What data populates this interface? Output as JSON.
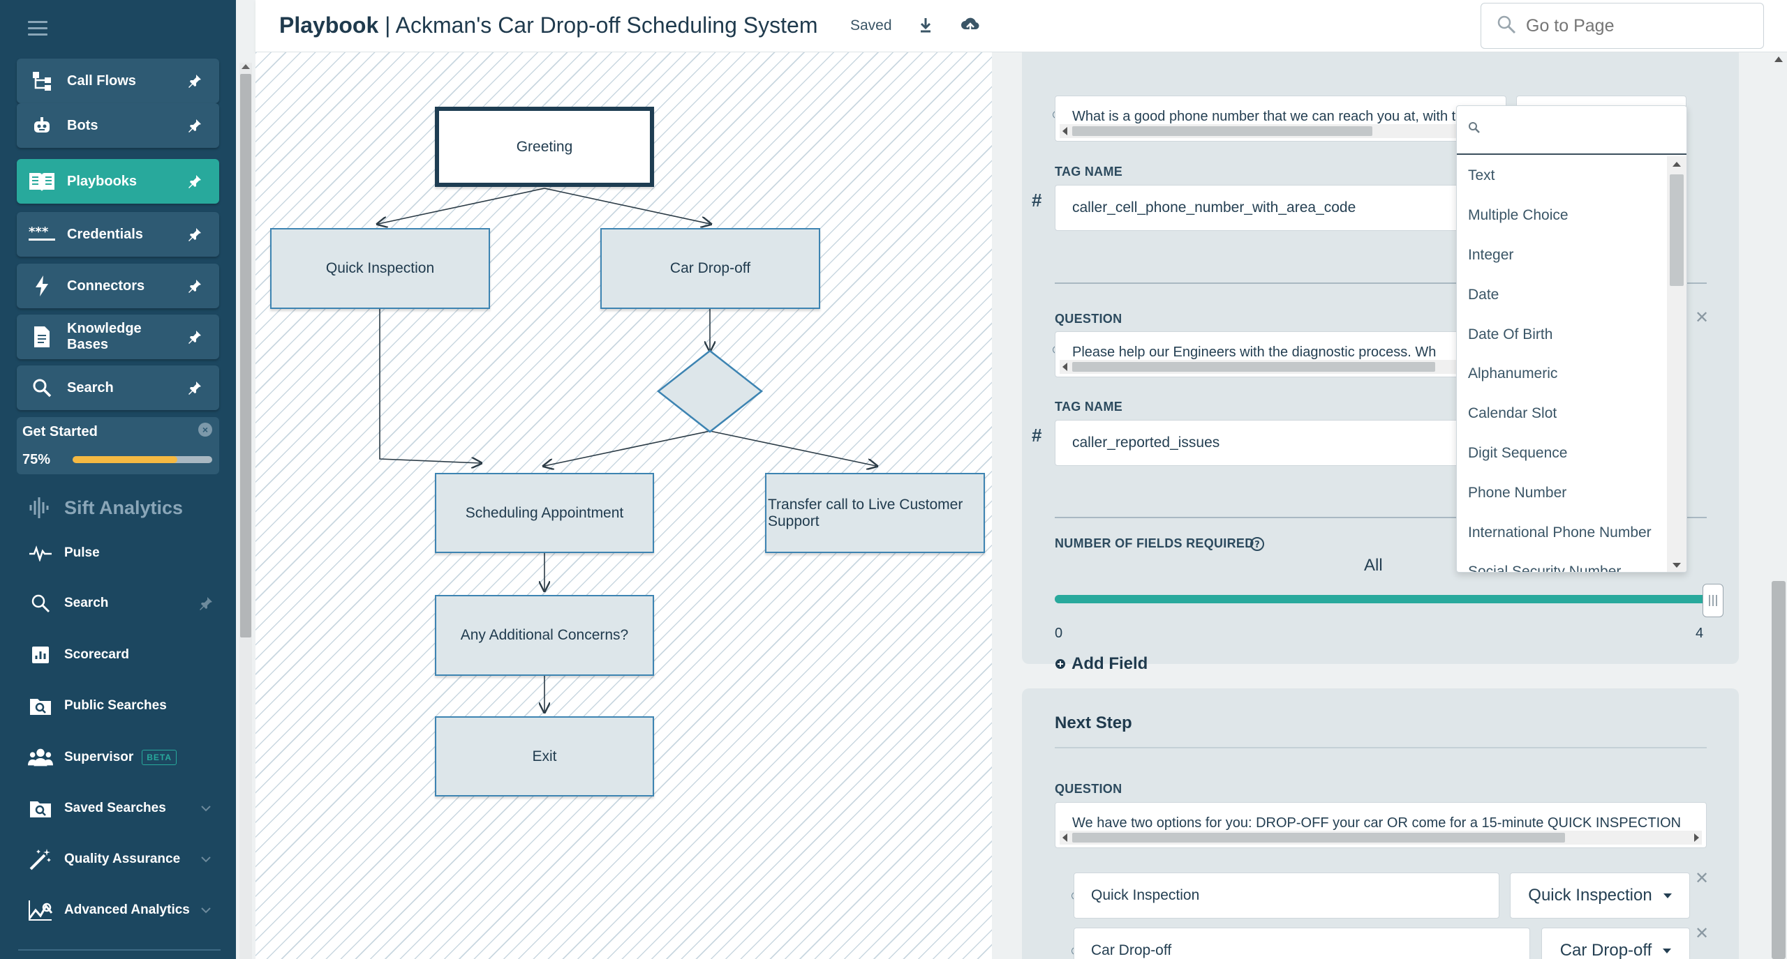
{
  "app": {
    "title_bold": "Playbook",
    "title_rest": "| Ackman's Car Drop-off Scheduling System",
    "saved": "Saved",
    "search_placeholder": "Go to Page"
  },
  "sidebar": {
    "pinned": [
      {
        "label": "Call Flows",
        "icon": "call-flows-icon"
      },
      {
        "label": "Bots",
        "icon": "bot-icon"
      },
      {
        "label": "Playbooks",
        "icon": "playbook-icon",
        "active": true
      },
      {
        "label": "Credentials",
        "icon": "credentials-icon"
      },
      {
        "label": "Connectors",
        "icon": "lightning-icon"
      },
      {
        "label": "Knowledge Bases",
        "icon": "document-icon"
      },
      {
        "label": "Search",
        "icon": "search-icon"
      }
    ],
    "get_started": {
      "label": "Get Started",
      "percent_label": "75%",
      "progress": 0.75
    },
    "section": "Sift Analytics",
    "items": [
      {
        "label": "Pulse",
        "icon": "pulse-icon"
      },
      {
        "label": "Search",
        "icon": "search-icon"
      },
      {
        "label": "Scorecard",
        "icon": "scorecard-icon"
      },
      {
        "label": "Public Searches",
        "icon": "public-search-icon"
      },
      {
        "label": "Supervisor",
        "icon": "supervisor-icon",
        "badge": "BETA"
      },
      {
        "label": "Saved Searches",
        "icon": "saved-search-icon"
      },
      {
        "label": "Quality Assurance",
        "icon": "wand-icon"
      },
      {
        "label": "Advanced Analytics",
        "icon": "analytics-icon"
      }
    ]
  },
  "flow": {
    "nodes": {
      "greeting": "Greeting",
      "quick": "Quick Inspection",
      "dropoff": "Car Drop-off",
      "scheduling": "Scheduling Appointment",
      "transfer": "Transfer call to Live Customer Support",
      "concerns": "Any Additional Concerns?",
      "exit": "Exit"
    }
  },
  "panel": {
    "q1": {
      "text": "What is a good phone number that we can reach you at, with the a",
      "type": "Phone Number"
    },
    "tag_label": "TAG NAME",
    "question_label": "QUESTION",
    "tag1": "caller_cell_phone_number_with_area_code",
    "q2": {
      "text": "Please help our Engineers with the diagnostic process. Wh"
    },
    "tag2": "caller_reported_issues",
    "fields_required_label": "NUMBER OF FIELDS REQUIRED",
    "fields_value": "All",
    "slider_min": "0",
    "slider_max": "4",
    "slider_value": 4,
    "add_field": "Add Field",
    "next_step": {
      "title": "Next Step",
      "question_label": "QUESTION",
      "question": "We have two options for you: DROP-OFF your car OR come for a 15-minute QUICK INSPECTION",
      "options": [
        {
          "text": "Quick Inspection",
          "target": "Quick Inspection"
        },
        {
          "text": "Car Drop-off",
          "target": "Car Drop-off"
        }
      ]
    }
  },
  "type_menu": {
    "options": [
      "Text",
      "Multiple Choice",
      "Integer",
      "Date",
      "Date Of Birth",
      "Alphanumeric",
      "Calendar Slot",
      "Digit Sequence",
      "Phone Number",
      "International Phone Number",
      "Social Security Number"
    ]
  },
  "colors": {
    "sidebar": "#1c4760",
    "accent": "#28a99c",
    "progress": "#f5b942",
    "node_border": "#3d84b2"
  }
}
